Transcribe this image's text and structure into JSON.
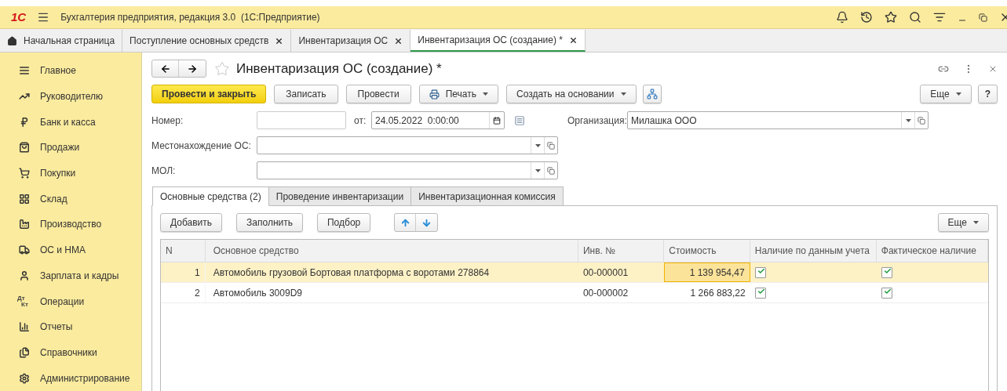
{
  "app_bar": {
    "logo": "1С",
    "title": "Бухгалтерия предприятия, редакция 3.0  (1С:Предприятие)"
  },
  "open_tabs": [
    {
      "label": "Начальная страница",
      "kind": "home",
      "selected": false
    },
    {
      "label": "Поступление основных средств",
      "kind": "doc",
      "selected": false
    },
    {
      "label": "Инвентаризация ОС",
      "kind": "doc",
      "selected": false
    },
    {
      "label": "Инвентаризация ОС (создание) *",
      "kind": "doc",
      "selected": true
    }
  ],
  "sidebar": {
    "items": [
      {
        "label": "Главное"
      },
      {
        "label": "Руководителю"
      },
      {
        "label": "Банк и касса"
      },
      {
        "label": "Продажи"
      },
      {
        "label": "Покупки"
      },
      {
        "label": "Склад"
      },
      {
        "label": "Производство"
      },
      {
        "label": "ОС и НМА"
      },
      {
        "label": "Зарплата и кадры"
      },
      {
        "label": "Операции",
        "icon_text": [
          "Дт",
          "Кт"
        ]
      },
      {
        "label": "Отчеты"
      },
      {
        "label": "Справочники"
      },
      {
        "label": "Администрирование"
      }
    ]
  },
  "form": {
    "title": "Инвентаризация ОС (создание) *",
    "commands": [
      {
        "label": "Провести и закрыть",
        "kind": "primary"
      },
      {
        "label": "Записать",
        "kind": "plain"
      },
      {
        "label": "Провести",
        "kind": "plain"
      },
      {
        "label": "Печать",
        "kind": "print"
      },
      {
        "label": "Создать на основании",
        "kind": "menu"
      },
      {
        "kind": "structure"
      }
    ],
    "more": "Еще",
    "help": "?",
    "number": {
      "label": "Номер:"
    },
    "date": {
      "label": "от:",
      "value": "24.05.2022  0:00:00"
    },
    "organization": {
      "label": "Организация:",
      "value": "Милашка ООО"
    },
    "location": {
      "label": "Местонахождение ОС:"
    },
    "mol": {
      "label": "МОЛ:"
    },
    "tabs": [
      {
        "label": "Основные средства (2)",
        "selected": true
      },
      {
        "label": "Проведение инвентаризации",
        "selected": false
      },
      {
        "label": "Инвентаризационная комиссия",
        "selected": false
      }
    ],
    "table_commands": [
      "Добавить",
      "Заполнить",
      "Подбор"
    ],
    "table_more": "Еще",
    "table": {
      "columns": [
        "N",
        "Основное средство",
        "Инв. №",
        "Стоимость",
        "Наличие по данным учета",
        "Фактическое наличие"
      ],
      "rows": [
        {
          "n": "1",
          "asset": "Автомобиль грузовой Бортовая платформа с воротами 278864",
          "inv": "00-000001",
          "cost": "1 139 954,47",
          "on_books": true,
          "actual": true,
          "selected": true
        },
        {
          "n": "2",
          "asset": "Автомобиль 3009D9",
          "inv": "00-000002",
          "cost": "1 266 883,22",
          "on_books": true,
          "actual": true,
          "selected": false
        }
      ]
    }
  }
}
